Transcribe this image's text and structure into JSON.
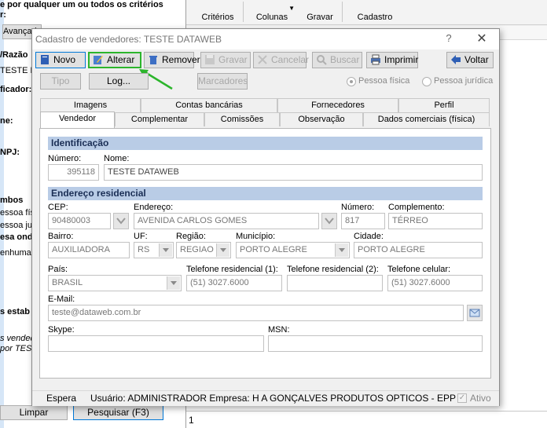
{
  "background": {
    "left_panel": {
      "lines": [
        "e por qualquer um ou todos os critérios",
        "r:",
        "Avançada",
        "/Razão",
        "TESTE DA",
        "ficador:",
        "ne:",
        "NPJ:",
        "mbos",
        "essoa físic",
        "essoa juríc",
        "esa onde",
        "enhuma)",
        "s estab",
        "s vended",
        "por TES"
      ],
      "limpar_label": "Limpar",
      "pesquisar_label": "Pesquisar (F3)"
    },
    "toolbar": {
      "criterios_label": "Critérios",
      "colunas_label": "Colunas",
      "gravar_label": "Gravar",
      "cadastro_label": "Cadastro"
    },
    "bottom_cell": "1"
  },
  "dialog": {
    "title": "Cadastro de vendedores: TESTE DATAWEB",
    "help": "?",
    "close": "✕",
    "toolbar": {
      "novo": "Novo",
      "alterar": "Alterar",
      "remover": "Remover",
      "gravar": "Gravar",
      "cancelar": "Cancelar",
      "buscar": "Buscar",
      "imprimir": "Imprimir",
      "voltar": "Voltar"
    },
    "toolbar2": {
      "tipo": "Tipo",
      "log": "Log...",
      "marcadores": "Marcadores",
      "pessoa_fisica": "Pessoa física",
      "pessoa_juridica": "Pessoa jurídica"
    },
    "tabs_row1": [
      "Imagens",
      "Contas bancárias",
      "Fornecedores",
      "Perfil"
    ],
    "tabs_row2": [
      "Vendedor",
      "Complementar",
      "Comissões",
      "Observação",
      "Dados comerciais (física)"
    ],
    "identificacao": {
      "header": "Identificação",
      "numero_label": "Número:",
      "numero_value": "395118",
      "nome_label": "Nome:",
      "nome_value": "TESTE DATAWEB"
    },
    "endereco": {
      "header": "Endereço residencial",
      "cep_label": "CEP:",
      "cep_value": "90480003",
      "endereco_label": "Endereço:",
      "endereco_value": "AVENIDA CARLOS GOMES",
      "numero_label": "Número:",
      "numero_value": "817",
      "complemento_label": "Complemento:",
      "complemento_value": "TÉRREO",
      "bairro_label": "Bairro:",
      "bairro_value": "AUXILIADORA",
      "uf_label": "UF:",
      "uf_value": "RS",
      "regiao_label": "Região:",
      "regiao_value": "REGIAO",
      "municipio_label": "Município:",
      "municipio_value": "PORTO ALEGRE",
      "cidade_label": "Cidade:",
      "cidade_value": "PORTO ALEGRE",
      "pais_label": "País:",
      "pais_value": "BRASIL",
      "tel1_label": "Telefone residencial (1):",
      "tel1_value": "(51) 3027.6000",
      "tel2_label": "Telefone residencial (2):",
      "tel2_value": "",
      "cel_label": "Telefone celular:",
      "cel_value": "(51) 3027.6000",
      "email_label": "E-Mail:",
      "email_value": "teste@dataweb.com.br",
      "skype_label": "Skype:",
      "skype_value": "",
      "msn_label": "MSN:",
      "msn_value": ""
    },
    "status": {
      "espera": "Espera",
      "usuario": "Usuário: ADMINISTRADOR Empresa: H A GONÇALVES PRODUTOS OPTICOS - EPP",
      "ativo": "Ativo"
    },
    "colors": {
      "section_bg": "#b9cce6",
      "highlight_border": "#2cb52c",
      "focus_border": "#0078d7"
    }
  }
}
